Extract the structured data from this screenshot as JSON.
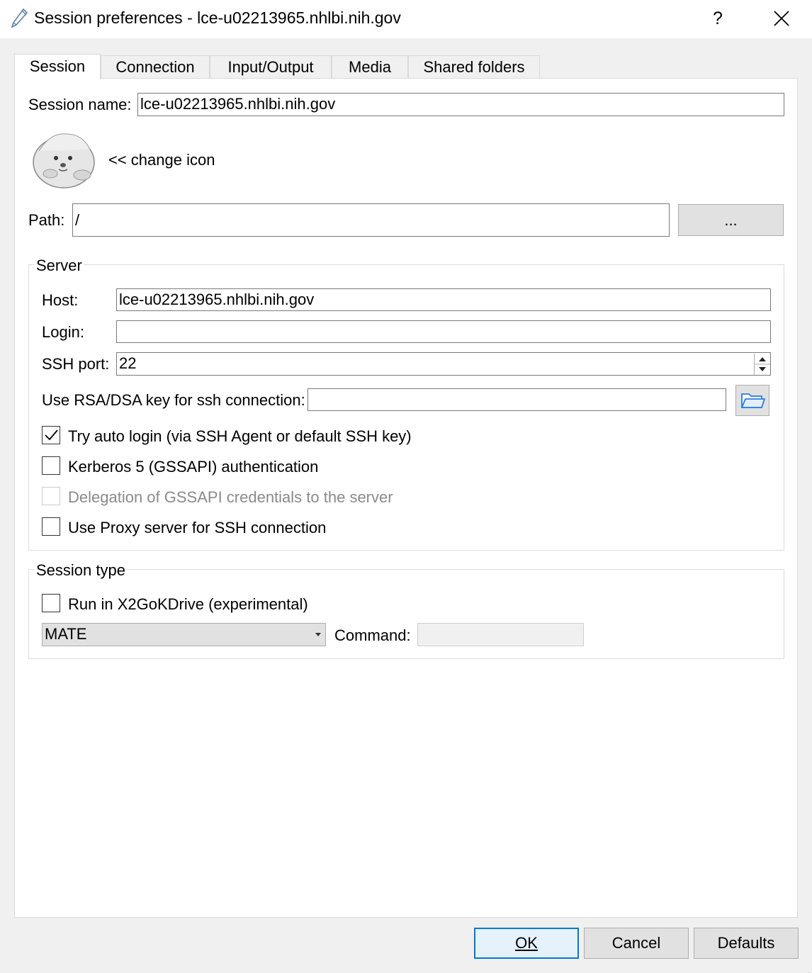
{
  "window": {
    "title": "Session preferences - lce-u02213965.nhlbi.nih.gov",
    "help_label": "?",
    "title_icon": "pencil-icon",
    "close_icon": "close-icon"
  },
  "tabs": [
    {
      "label": "Session",
      "active": true
    },
    {
      "label": "Connection",
      "active": false
    },
    {
      "label": "Input/Output",
      "active": false
    },
    {
      "label": "Media",
      "active": false
    },
    {
      "label": "Shared folders",
      "active": false
    }
  ],
  "session": {
    "name_label": "Session name:",
    "name_value": "lce-u02213965.nhlbi.nih.gov",
    "change_icon_label": "<< change icon",
    "session_icon": "seal-icon",
    "path_label": "Path:",
    "path_value": "/",
    "browse_label": "..."
  },
  "server": {
    "title": "Server",
    "host_label": "Host:",
    "host_value": "lce-u02213965.nhlbi.nih.gov",
    "login_label": "Login:",
    "login_value": "",
    "port_label": "SSH port:",
    "port_value": "22",
    "key_label": "Use RSA/DSA key for ssh connection:",
    "key_value": "",
    "key_browse_icon": "folder-icon",
    "options": [
      {
        "label": "Try auto login (via SSH Agent or default SSH key)",
        "checked": true,
        "enabled": true
      },
      {
        "label": "Kerberos 5 (GSSAPI) authentication",
        "checked": false,
        "enabled": true
      },
      {
        "label": "Delegation of GSSAPI credentials to the server",
        "checked": false,
        "enabled": false
      },
      {
        "label": "Use Proxy server for SSH connection",
        "checked": false,
        "enabled": true
      }
    ]
  },
  "session_type": {
    "title": "Session type",
    "x2gokdrive_label": "Run in X2GoKDrive (experimental)",
    "x2gokdrive_checked": false,
    "type_value": "MATE",
    "command_label": "Command:",
    "command_value": ""
  },
  "buttons": {
    "ok": "OK",
    "cancel": "Cancel",
    "defaults": "Defaults"
  },
  "colors": {
    "accent": "#0078d7",
    "folder": "#2a7de1"
  }
}
